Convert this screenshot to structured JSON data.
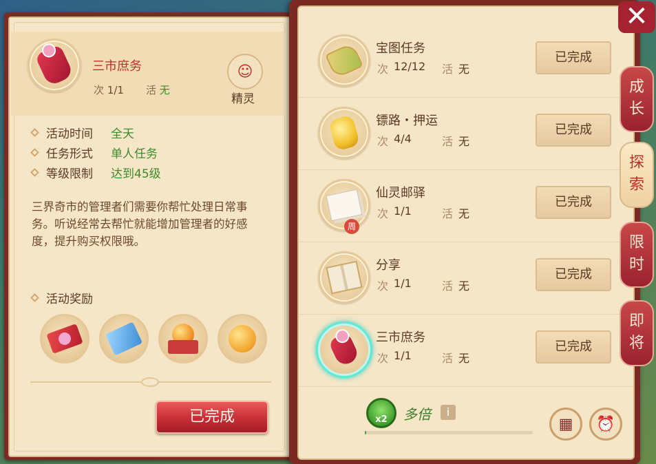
{
  "detail": {
    "title": "三市庶务",
    "count_label": "次",
    "count_value": "1/1",
    "active_label": "活",
    "active_value": "无",
    "spirit_label": "精灵",
    "info": [
      {
        "key": "活动时间",
        "value": "全天"
      },
      {
        "key": "任务形式",
        "value": "单人任务"
      },
      {
        "key": "等级限制",
        "value": "达到45级"
      }
    ],
    "description": "三界奇市的管理者们需要你帮忙处理日常事务。听说经常去帮忙就能增加管理者的好感度，提升购买权限哦。",
    "rewards_title": "活动奖励",
    "done_label": "已完成"
  },
  "tasks": [
    {
      "name": "宝图任务",
      "count": "12/12",
      "active": "无",
      "button": "已完成",
      "icon": "treasure-map-icon"
    },
    {
      "name": "镖路・押运",
      "count": "4/4",
      "active": "无",
      "button": "已完成",
      "icon": "gold-ingot-icon"
    },
    {
      "name": "仙灵邮驿",
      "count": "1/1",
      "active": "无",
      "button": "已完成",
      "icon": "letter-icon",
      "badge": "周"
    },
    {
      "name": "分享",
      "count": "1/1",
      "active": "无",
      "button": "已完成",
      "icon": "book-icon"
    },
    {
      "name": "三市庶务",
      "count": "1/1",
      "active": "无",
      "button": "已完成",
      "icon": "pouch-icon"
    }
  ],
  "task_labels": {
    "count": "次",
    "active": "活"
  },
  "bottom": {
    "multi_badge": "x2",
    "multi_label": "多倍",
    "info": "i",
    "progress": 0.01
  },
  "side_tabs": [
    "成长",
    "探索",
    "限时",
    "即将"
  ],
  "close": "✕"
}
